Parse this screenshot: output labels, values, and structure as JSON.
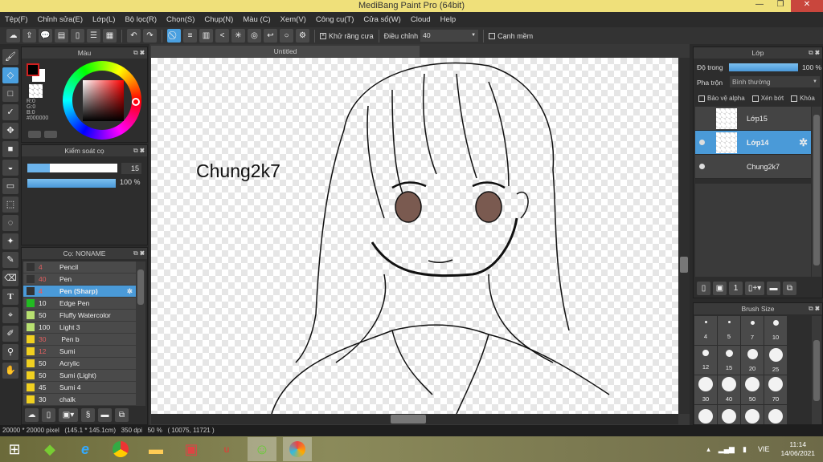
{
  "title": "MediBang Paint Pro (64bit)",
  "menu": [
    "Tệp(F)",
    "Chỉnh sửa(E)",
    "Lớp(L)",
    "Bộ lọc(R)",
    "Chọn(S)",
    "Chụp(N)",
    "Màu (C)",
    "Xem(V)",
    "Công cụ(T)",
    "Cửa sổ(W)",
    "Cloud",
    "Help"
  ],
  "toolbar": {
    "antialias_label": "Khử răng cưa",
    "antialias_checked": true,
    "adjust_label": "Điều chỉnh",
    "adjust_value": "40",
    "soft_edge_label": "Cạnh mềm",
    "soft_edge_checked": false
  },
  "color_panel": {
    "title": "Màu",
    "r": "R:0",
    "g": "G:0",
    "b": "B:0",
    "hex": "#000000",
    "primary": "#000000",
    "secondary": "#ffffff"
  },
  "brush_control": {
    "title": "Kiểm soát cọ",
    "size": "15",
    "opacity": "100 %",
    "size_fraction": 0.25,
    "opacity_fraction": 1.0
  },
  "brush_panel": {
    "title": "Cọ: NONAME",
    "items": [
      {
        "size": "4",
        "name": "Pencil",
        "color": "#333333",
        "size_color": "#e06060"
      },
      {
        "size": "40",
        "name": "Pen",
        "color": "#333333",
        "size_color": "#e06060"
      },
      {
        "size": "4",
        "name": "Pen (Sharp)",
        "color": "#333333",
        "size_color": "#e06060",
        "selected": true
      },
      {
        "size": "10",
        "name": "Edge Pen",
        "color": "#22bb22",
        "size_color": "#eeeeee"
      },
      {
        "size": "50",
        "name": "Fluffy Watercolor",
        "color": "#b8e070",
        "size_color": "#eeeeee"
      },
      {
        "size": "100",
        "name": "Light 3",
        "color": "#b8e070",
        "size_color": "#eeeeee"
      },
      {
        "size": "30",
        "name": " Pen b",
        "color": "#f0d020",
        "size_color": "#e06060"
      },
      {
        "size": "12",
        "name": "Sumi",
        "color": "#f0d020",
        "size_color": "#e06060"
      },
      {
        "size": "50",
        "name": "Acrylic",
        "color": "#f0d020",
        "size_color": "#eeeeee"
      },
      {
        "size": "50",
        "name": "Sumi (Light)",
        "color": "#f0d020",
        "size_color": "#eeeeee"
      },
      {
        "size": "45",
        "name": "Sumi 4",
        "color": "#f0d020",
        "size_color": "#eeeeee"
      },
      {
        "size": "30",
        "name": "chalk",
        "color": "#f0d020",
        "size_color": "#eeeeee"
      }
    ]
  },
  "document": {
    "tab": "Untitled",
    "canvas_text": "Chung2k7"
  },
  "layer_panel": {
    "title": "Lớp",
    "opacity_label": "Độ trong",
    "opacity_value": "100 %",
    "blend_label": "Pha trộn",
    "blend_value": "Bình thường",
    "protect_alpha": "Bảo vệ alpha",
    "clip": "Xén bớt",
    "lock": "Khóa",
    "layers": [
      {
        "name": "Lớp15",
        "visible": false
      },
      {
        "name": "Lớp14",
        "visible": true,
        "selected": true
      },
      {
        "name": "Chung2k7",
        "visible": true
      }
    ]
  },
  "brush_size_panel": {
    "title": "Brush Size",
    "sizes": [
      "4",
      "5",
      "7",
      "10",
      "12",
      "15",
      "20",
      "25",
      "30",
      "40",
      "50",
      "70",
      "",
      "",
      "",
      ""
    ]
  },
  "status": {
    "dimensions": "20000 * 20000 pixel",
    "physical": "(145.1 * 145.1cm)",
    "dpi": "350 dpi",
    "zoom": "50 %",
    "coords": "( 10075, 11721 )"
  },
  "taskbar": {
    "lang": "VIE",
    "time": "11:14",
    "date": "14/06/2021"
  },
  "accent": "#4a9ad8"
}
